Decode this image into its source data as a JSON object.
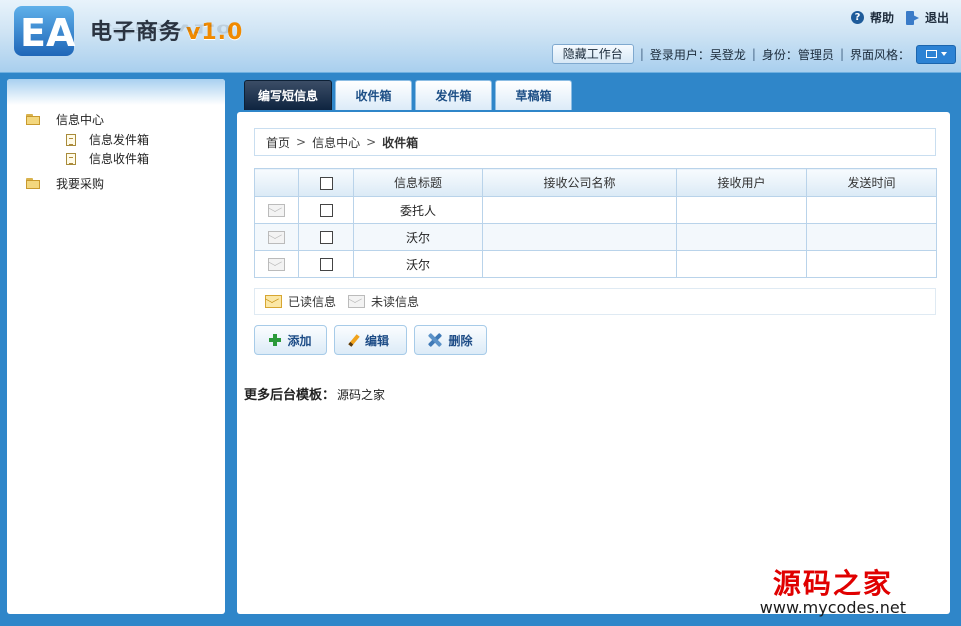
{
  "header": {
    "app_title": "电子商务",
    "app_version": "v1.0",
    "help_label": "帮助",
    "logout_label": "退出",
    "hide_button_label": "隐藏工作台",
    "login_user_label": "登录用户：吴登龙",
    "identity_label": "身份：管理员",
    "skin_label": "界面风格："
  },
  "sidebar": {
    "items": [
      {
        "label": "信息中心",
        "type": "folder"
      },
      {
        "label": "信息发件箱",
        "type": "doc"
      },
      {
        "label": "信息收件箱",
        "type": "doc"
      },
      {
        "label": "我要采购",
        "type": "folder"
      }
    ]
  },
  "tabs": [
    {
      "label": "编写短信息",
      "active": true
    },
    {
      "label": "收件箱",
      "active": false
    },
    {
      "label": "发件箱",
      "active": false
    },
    {
      "label": "草稿箱",
      "active": false
    }
  ],
  "breadcrumb": {
    "home": "首页",
    "section": "信息中心",
    "current": "收件箱",
    "separator": ">"
  },
  "table": {
    "columns": [
      "信息标题",
      "接收公司名称",
      "接收用户",
      "发送时间"
    ],
    "rows": [
      {
        "title": "委托人",
        "company": "",
        "user": "",
        "time": "",
        "status": "read"
      },
      {
        "title": "沃尔",
        "company": "",
        "user": "",
        "time": "",
        "status": "read"
      },
      {
        "title": "沃尔",
        "company": "",
        "user": "",
        "time": "",
        "status": "read"
      }
    ]
  },
  "legend": {
    "read_label": "已读信息",
    "unread_label": "未读信息"
  },
  "actions": {
    "add_label": "添加",
    "edit_label": "编辑",
    "delete_label": "删除"
  },
  "footer_note": {
    "label": "更多后台模板：",
    "value": "源码之家"
  },
  "watermark": {
    "cn": "源码之家",
    "url": "www.mycodes.net"
  },
  "colors": {
    "page_bg": "#2f86c9",
    "active_tab": "#0e2440",
    "version_accent": "#f08a00",
    "watermark_red": "#e00000"
  }
}
